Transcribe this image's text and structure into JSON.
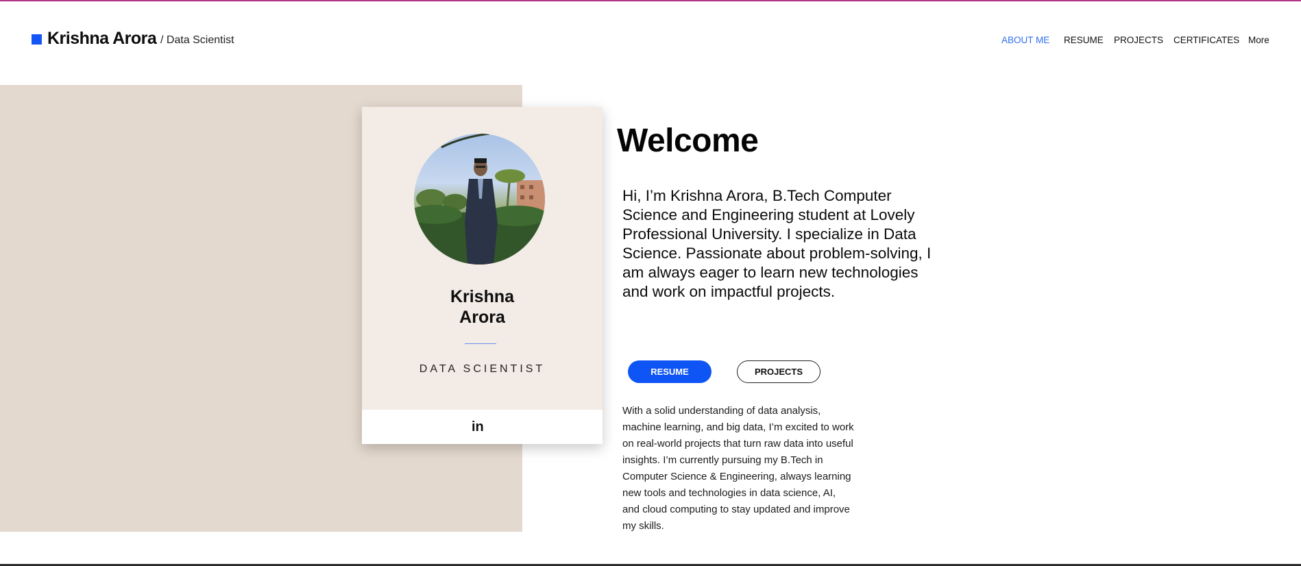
{
  "header": {
    "brand_name": "Krishna Arora",
    "brand_tag": "/ Data Scientist",
    "nav": [
      {
        "label": "ABOUT ME",
        "active": true
      },
      {
        "label": "RESUME",
        "active": false
      },
      {
        "label": "PROJECTS",
        "active": false
      },
      {
        "label": "CERTIFICATES",
        "active": false
      },
      {
        "label": "More",
        "active": false
      }
    ]
  },
  "card": {
    "name_line1": "Krishna",
    "name_line2": "Arora",
    "title": "DATA SCIENTIST",
    "social_icon": "linkedin-icon",
    "social_text": "in"
  },
  "main": {
    "heading": "Welcome",
    "intro": "Hi, I’m Krishna Arora,  B.Tech Computer Science and Engineering student at Lovely Professional University. I specialize in Data Science. Passionate about problem-solving, I am always eager to learn new technologies and work on impactful projects.",
    "resume_button": "RESUME",
    "projects_button": "PROJECTS",
    "details": "With a solid understanding of data analysis, machine learning, and big data, I’m excited to work on real-world projects that turn raw data into useful insights. I’m currently pursuing my B.Tech in Computer Science & Engineering, always learning new tools and technologies in data science, AI, and cloud computing to stay updated and improve my skills."
  },
  "colors": {
    "accent": "#1455f5",
    "nav_active": "#2f6ff0",
    "backdrop": "#e4d9ce",
    "card": "#f2ebe6"
  }
}
